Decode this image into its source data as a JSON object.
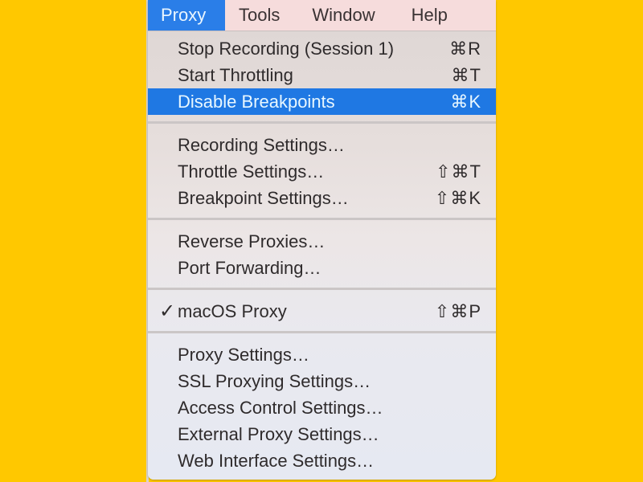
{
  "menubar": {
    "items": [
      {
        "label": "Proxy",
        "active": true
      },
      {
        "label": "Tools",
        "active": false
      },
      {
        "label": "Window",
        "active": false
      },
      {
        "label": "Help",
        "active": false
      }
    ]
  },
  "menu": {
    "groups": [
      [
        {
          "label": "Stop Recording (Session 1)",
          "shortcut": "⌘R"
        },
        {
          "label": "Start Throttling",
          "shortcut": "⌘T"
        },
        {
          "label": "Disable Breakpoints",
          "shortcut": "⌘K",
          "highlighted": true
        }
      ],
      [
        {
          "label": "Recording Settings…",
          "shortcut": ""
        },
        {
          "label": "Throttle Settings…",
          "shortcut": "⇧⌘T"
        },
        {
          "label": "Breakpoint Settings…",
          "shortcut": "⇧⌘K"
        }
      ],
      [
        {
          "label": "Reverse Proxies…",
          "shortcut": ""
        },
        {
          "label": "Port Forwarding…",
          "shortcut": ""
        }
      ],
      [
        {
          "label": "macOS Proxy",
          "shortcut": "⇧⌘P",
          "checked": true,
          "check_mark": "✓"
        }
      ],
      [
        {
          "label": "Proxy Settings…",
          "shortcut": ""
        },
        {
          "label": "SSL Proxying Settings…",
          "shortcut": ""
        },
        {
          "label": "Access Control Settings…",
          "shortcut": ""
        },
        {
          "label": "External Proxy Settings…",
          "shortcut": ""
        },
        {
          "label": "Web Interface Settings…",
          "shortcut": ""
        }
      ]
    ]
  },
  "colors": {
    "background": "#FFC800",
    "highlight": "#1F78E3",
    "menubar_active": "#2A7EE8",
    "menubar_bg": "#F6DCDC"
  }
}
